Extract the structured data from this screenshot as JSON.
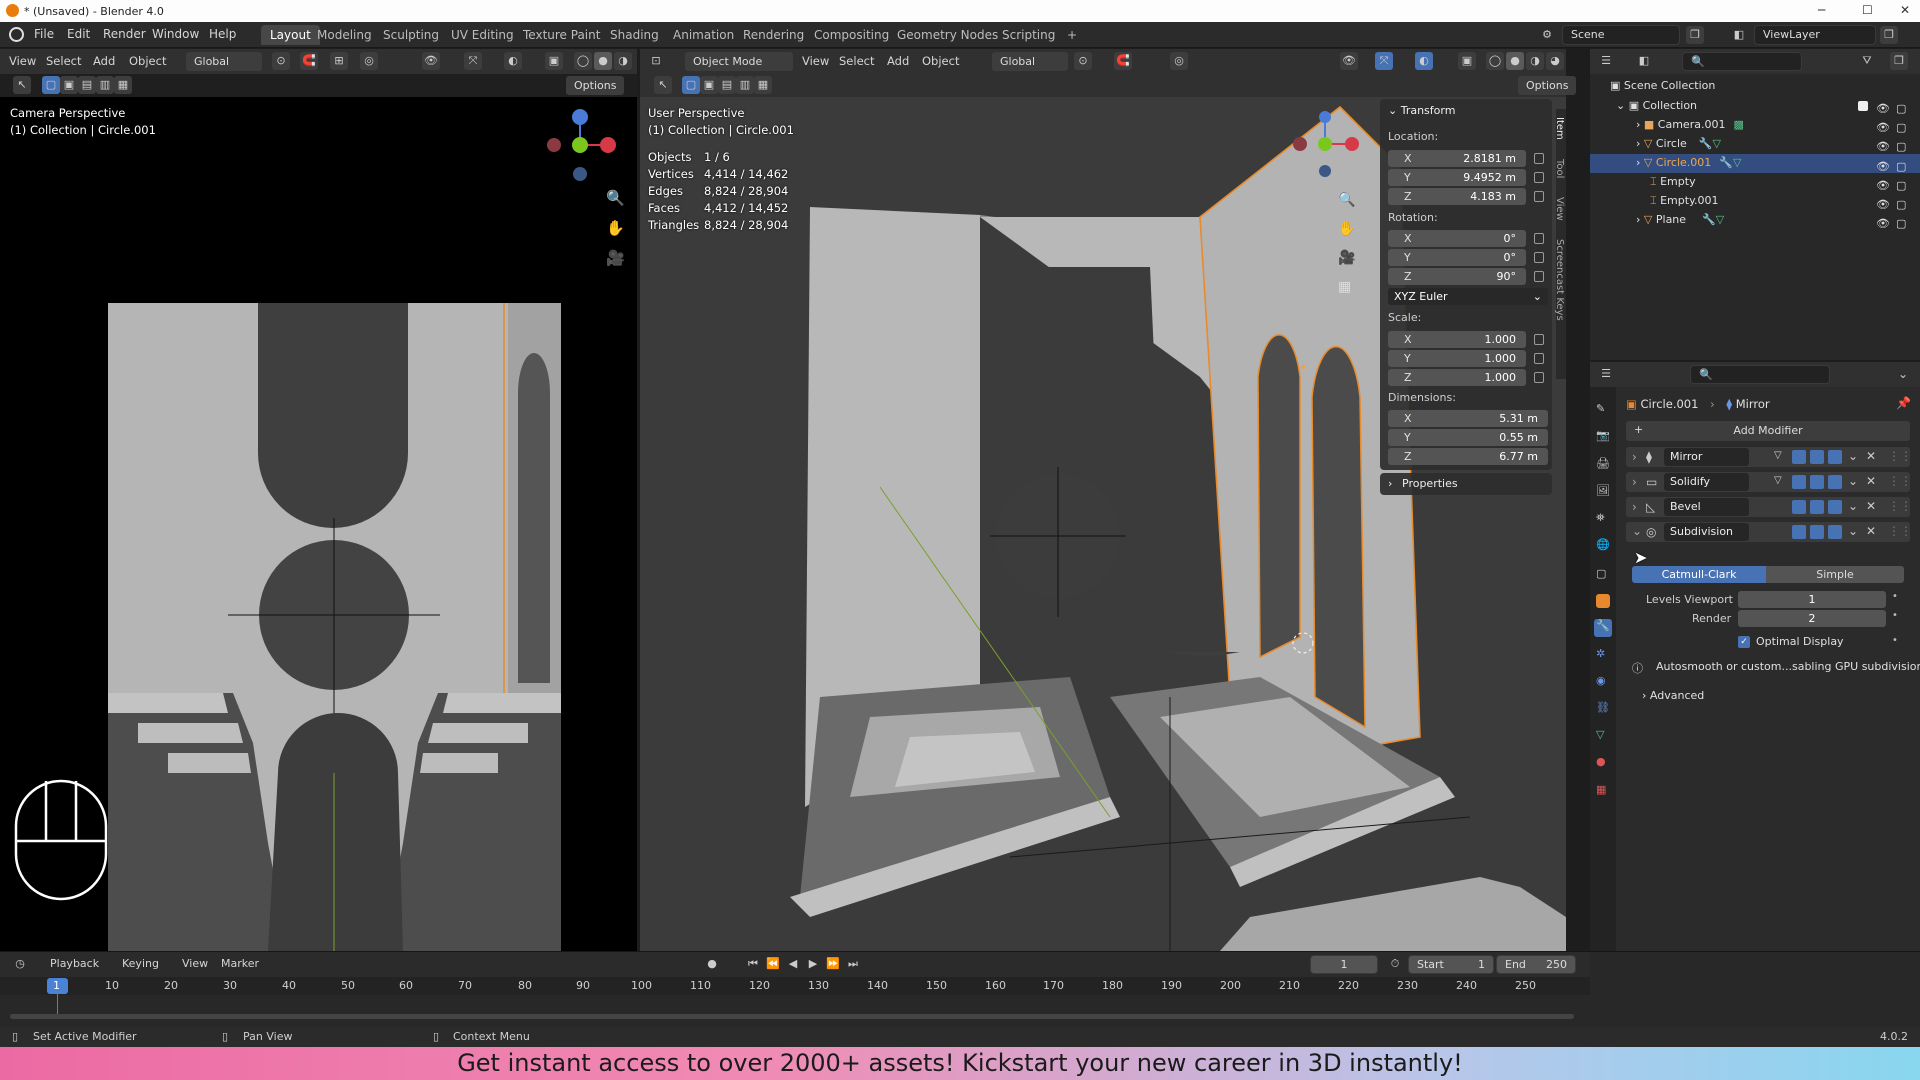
{
  "window": {
    "title": "* (Unsaved) - Blender 4.0",
    "min": "─",
    "max": "☐",
    "close": "✕"
  },
  "menu": [
    "File",
    "Edit",
    "Render",
    "Window",
    "Help"
  ],
  "workspaces": [
    "Layout",
    "Modeling",
    "Sculpting",
    "UV Editing",
    "Texture Paint",
    "Shading",
    "Animation",
    "Rendering",
    "Compositing",
    "Geometry Nodes",
    "Scripting",
    "+"
  ],
  "scene": "Scene",
  "view_layer": "ViewLayer",
  "left_view": {
    "menu": [
      "View",
      "Select",
      "Add",
      "Object"
    ],
    "orientation": "Global",
    "options": "Options",
    "persp": "Camera Perspective",
    "collection": "(1) Collection | Circle.001"
  },
  "right_view": {
    "mode": "Object Mode",
    "menu": [
      "View",
      "Select",
      "Add",
      "Object"
    ],
    "orientation": "Global",
    "options": "Options",
    "persp": "User Perspective",
    "collection": "(1) Collection | Circle.001",
    "stats": [
      {
        "k": "Objects",
        "v": "1 / 6"
      },
      {
        "k": "Vertices",
        "v": "4,414 / 14,462"
      },
      {
        "k": "Edges",
        "v": "8,824 / 28,904"
      },
      {
        "k": "Faces",
        "v": "4,412 / 14,452"
      },
      {
        "k": "Triangles",
        "v": "8,824 / 28,904"
      }
    ]
  },
  "npanel": {
    "title": "Transform",
    "location_label": "Location:",
    "location": [
      {
        "a": "X",
        "v": "2.8181 m"
      },
      {
        "a": "Y",
        "v": "9.4952 m"
      },
      {
        "a": "Z",
        "v": "4.183 m"
      }
    ],
    "rotation_label": "Rotation:",
    "rotation": [
      {
        "a": "X",
        "v": "0°"
      },
      {
        "a": "Y",
        "v": "0°"
      },
      {
        "a": "Z",
        "v": "90°"
      }
    ],
    "rotation_mode": "XYZ Euler",
    "scale_label": "Scale:",
    "scale": [
      {
        "a": "X",
        "v": "1.000"
      },
      {
        "a": "Y",
        "v": "1.000"
      },
      {
        "a": "Z",
        "v": "1.000"
      }
    ],
    "dimensions_label": "Dimensions:",
    "dimensions": [
      {
        "a": "X",
        "v": "5.31 m"
      },
      {
        "a": "Y",
        "v": "0.55 m"
      },
      {
        "a": "Z",
        "v": "6.77 m"
      }
    ],
    "properties": "Properties",
    "tabs": [
      "Item",
      "Tool",
      "View",
      "Screencast Keys"
    ]
  },
  "outliner": {
    "root": "Scene Collection",
    "collection": "Collection",
    "items": [
      "Camera.001",
      "Circle",
      "Circle.001",
      "Empty",
      "Empty.001",
      "Plane"
    ],
    "selected": "Circle.001"
  },
  "properties": {
    "object": "Circle.001",
    "modifier_ref": "Mirror",
    "add_modifier": "Add Modifier",
    "modifiers": [
      "Mirror",
      "Solidify",
      "Bevel",
      "Subdivision"
    ],
    "subdiv": {
      "catmull": "Catmull-Clark",
      "simple": "Simple",
      "levels_label": "Levels Viewport",
      "levels": "1",
      "render_label": "Render",
      "render": "2",
      "optimal": "Optimal Display",
      "warning": "Autosmooth or custom...sabling GPU subdivision",
      "advanced": "Advanced"
    }
  },
  "timeline": {
    "menu": [
      "Playback",
      "Keying",
      "View",
      "Marker"
    ],
    "current": "1",
    "start_label": "Start",
    "start": "1",
    "end_label": "End",
    "end": "250",
    "ticks": [
      "1",
      "10",
      "20",
      "30",
      "40",
      "50",
      "60",
      "70",
      "80",
      "90",
      "100",
      "110",
      "120",
      "130",
      "140",
      "150",
      "160",
      "170",
      "180",
      "190",
      "200",
      "210",
      "220",
      "230",
      "240",
      "250"
    ]
  },
  "status": {
    "left": "Set Active Modifier",
    "mid": "Pan View",
    "right": "Context Menu",
    "version": "4.0.2"
  },
  "banner": "Get instant access to over 2000+ assets! Kickstart your new career in 3D instantly!",
  "colors": {
    "accent": "#4772b3",
    "selected_outline": "#e98b2a",
    "timeline_marker": "#4a82d6"
  }
}
